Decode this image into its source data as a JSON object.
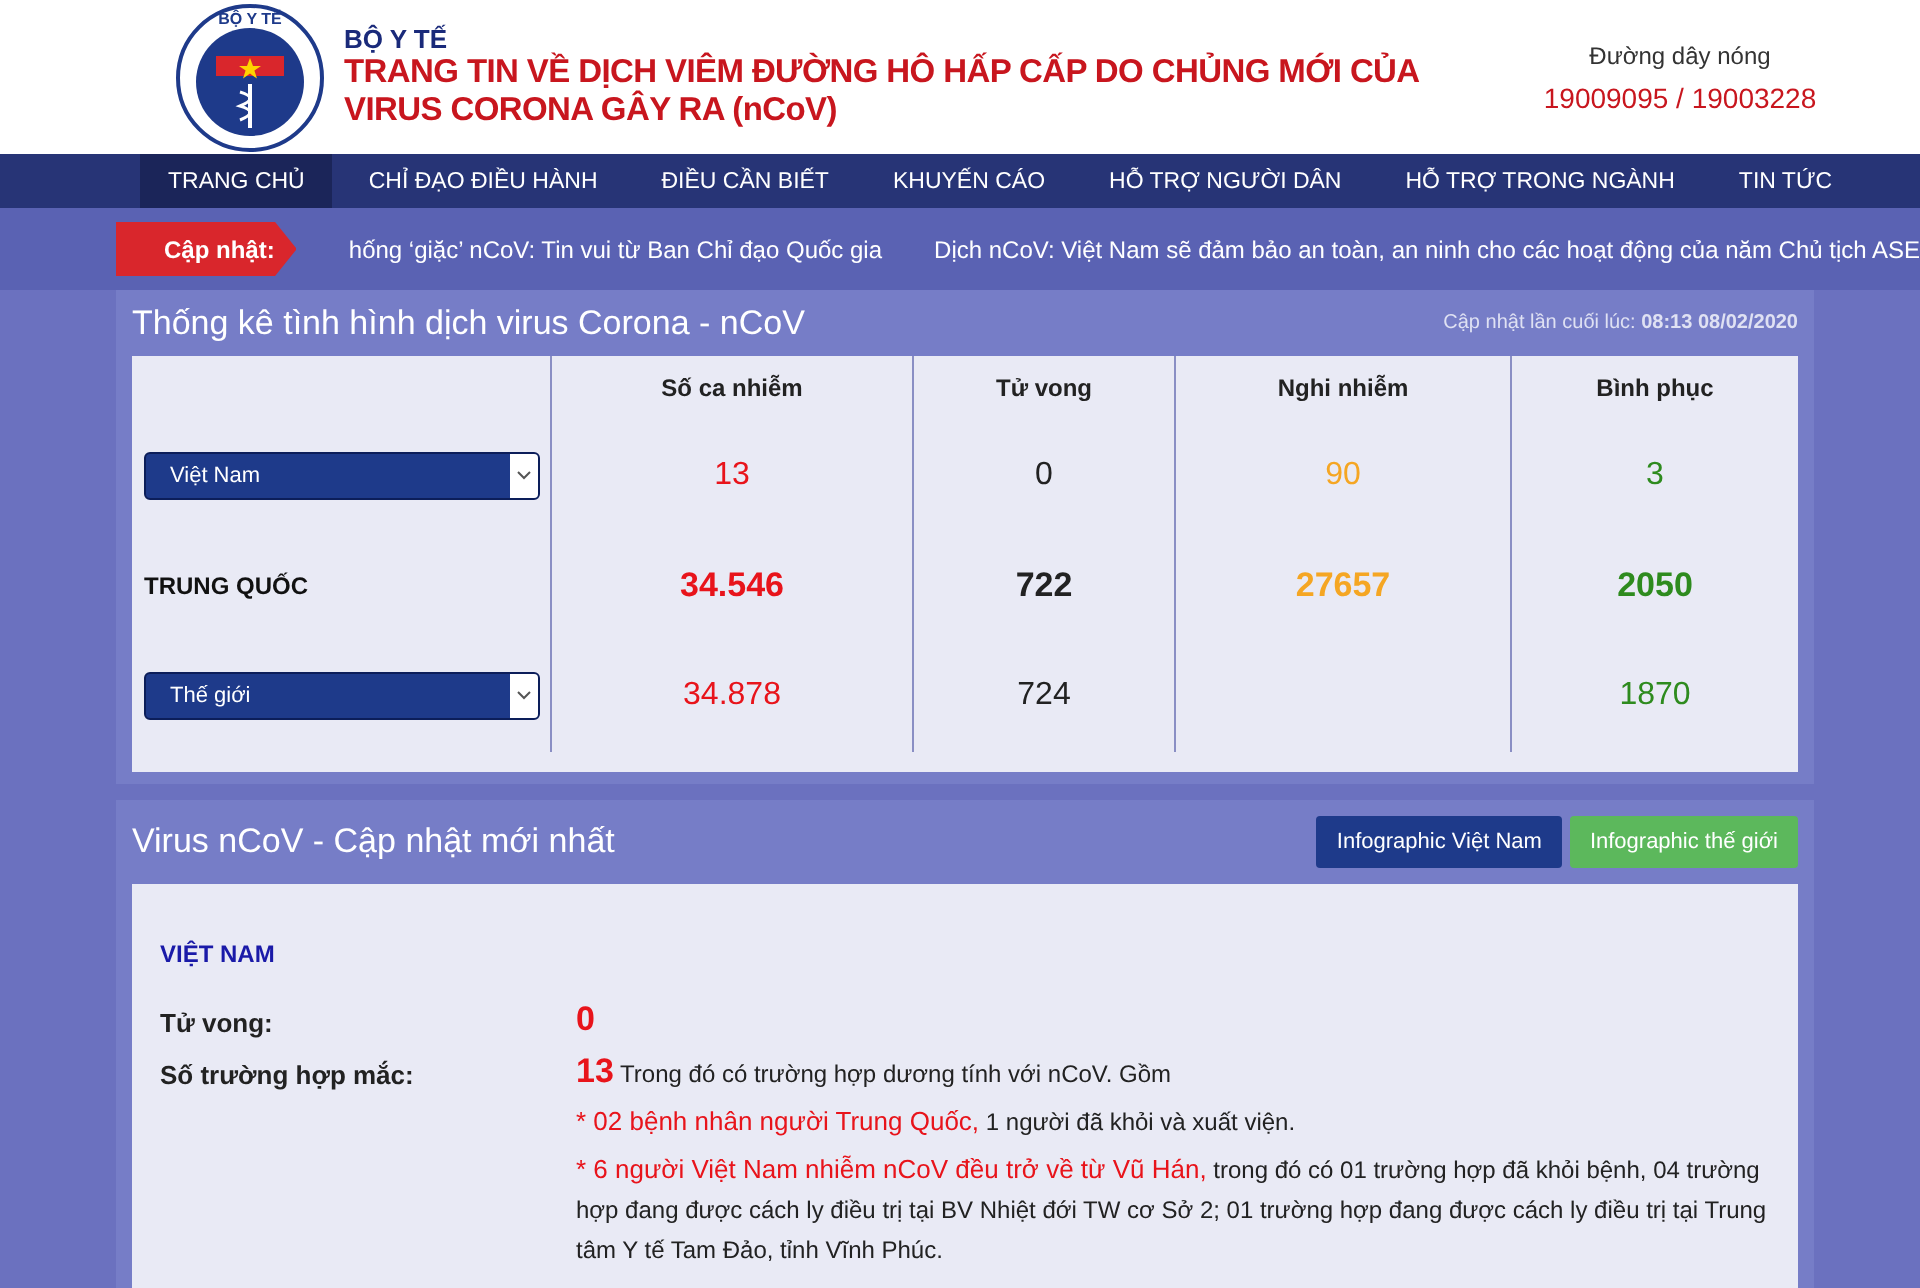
{
  "header": {
    "logo_ring_text": "BỘ Y TẾ",
    "ministry": "BỘ Y TẾ",
    "title_lines": [
      "TRANG TIN VỀ DỊCH VIÊM ĐƯỜNG HÔ HẤP CẤP DO CHỦNG MỚI CỦA",
      "VIRUS CORONA GÂY RA (nCoV)"
    ],
    "hotline_label": "Đường dây nóng",
    "hotline": "19009095 / 19003228"
  },
  "nav": [
    {
      "label": "TRANG CHỦ",
      "selected": true
    },
    {
      "label": "CHỈ ĐẠO ĐIỀU HÀNH",
      "selected": false
    },
    {
      "label": "ĐIỀU CẦN BIẾT",
      "selected": false
    },
    {
      "label": "KHUYẾN CÁO",
      "selected": false
    },
    {
      "label": "HỖ TRỢ NGƯỜI DÂN",
      "selected": false
    },
    {
      "label": "HỖ TRỢ TRONG NGÀNH",
      "selected": false
    },
    {
      "label": "TIN TỨC",
      "selected": false
    }
  ],
  "ticker": {
    "label": "Cập nhật:",
    "items": [
      "hống ‘giặc’ nCoV: Tin vui từ Ban Chỉ đạo Quốc gia",
      "Dịch nCoV: Việt Nam sẽ đảm bảo an toàn, an ninh cho các hoạt động của năm Chủ tịch ASE"
    ]
  },
  "stats": {
    "title": "Thống kê tình hình dịch virus Corona - nCoV",
    "updated_label": "Cập nhật lần cuối lúc:",
    "updated_time": "08:13 08/02/2020",
    "columns": [
      {
        "label": "Số ca nhiễm",
        "color": "#e8141b"
      },
      {
        "label": "Tử vong",
        "color": "#222222"
      },
      {
        "label": "Nghi nhiễm",
        "color": "#f5a623"
      },
      {
        "label": "Bình phục",
        "color": "#2e8b1e"
      }
    ],
    "rows": [
      {
        "kind": "select",
        "label": "Việt Nam",
        "bold": false,
        "cells": [
          {
            "kind": "number",
            "text": "13"
          },
          {
            "kind": "number",
            "text": "0"
          },
          {
            "kind": "number",
            "text": "90"
          },
          {
            "kind": "number",
            "text": "3"
          }
        ]
      },
      {
        "kind": "label",
        "label": "TRUNG QUỐC",
        "bold": true,
        "cells": [
          {
            "kind": "number",
            "text": "34.546"
          },
          {
            "kind": "number",
            "text": "722"
          },
          {
            "kind": "number",
            "text": "27657"
          },
          {
            "kind": "number",
            "text": "2050"
          }
        ]
      },
      {
        "kind": "select",
        "label": "Thế giới",
        "bold": false,
        "cells": [
          {
            "kind": "number",
            "text": "34.878"
          },
          {
            "kind": "number",
            "text": "724"
          },
          {
            "kind": "blank"
          },
          {
            "kind": "number",
            "text": "1870"
          }
        ]
      }
    ]
  },
  "latest": {
    "title": "Virus nCoV - Cập nhật mới nhất",
    "buttons": [
      {
        "label": "Infographic Việt Nam",
        "kind": "primary"
      },
      {
        "label": "Infographic thế giới",
        "kind": "success"
      }
    ],
    "region": "VIỆT NAM",
    "deaths_label": "Tử vong:",
    "deaths": "0",
    "cases_label": "Số trường hợp mắc:",
    "cases": "13",
    "cases_text": "Trong đó có trường hợp dương tính với nCoV. Gồm",
    "notes": [
      {
        "highlight": "* 02 bệnh nhân người Trung Quốc,",
        "text": "1 người đã khỏi và xuất viện."
      },
      {
        "highlight": "* 6 người Việt Nam nhiễm nCoV đều trở về từ Vũ Hán,",
        "text": "trong đó có 01 trường hợp đã khỏi bệnh, 04 trường hợp đang được cách ly điều trị tại BV Nhiệt đới TW cơ Sở 2; 01 trường hợp đang được cách ly điều trị tại Trung tâm Y tế Tam Đảo, tỉnh Vĩnh Phúc."
      }
    ]
  }
}
